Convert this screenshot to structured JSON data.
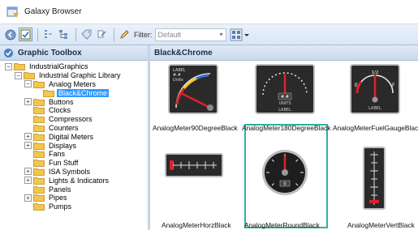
{
  "window": {
    "title": "Galaxy Browser"
  },
  "toolbar": {
    "filter_label": "Filter:",
    "filter_value": "Default",
    "buttons": [
      "back-icon",
      "library-icon",
      "tree-icon",
      "hierarchy-icon",
      "tag-icon",
      "link-icon",
      "edit-icon"
    ]
  },
  "left_panel": {
    "title": "Graphic Toolbox",
    "tree": [
      {
        "label": "IndustrialGraphics",
        "level": 0,
        "expander": "−"
      },
      {
        "label": "Industrial Graphic Library",
        "level": 1,
        "expander": "−"
      },
      {
        "label": "Analog Meters",
        "level": 2,
        "expander": "−"
      },
      {
        "label": "Black&Chrome",
        "level": 3,
        "expander": "",
        "selected": true
      },
      {
        "label": "Buttons",
        "level": 2,
        "expander": "+"
      },
      {
        "label": "Clocks",
        "level": 2,
        "expander": ""
      },
      {
        "label": "Compressors",
        "level": 2,
        "expander": ""
      },
      {
        "label": "Counters",
        "level": 2,
        "expander": ""
      },
      {
        "label": "Digital Meters",
        "level": 2,
        "expander": "+"
      },
      {
        "label": "Displays",
        "level": 2,
        "expander": "+"
      },
      {
        "label": "Fans",
        "level": 2,
        "expander": ""
      },
      {
        "label": "Fun Stuff",
        "level": 2,
        "expander": ""
      },
      {
        "label": "ISA Symbols",
        "level": 2,
        "expander": "+"
      },
      {
        "label": "Lights & Indicators",
        "level": 2,
        "expander": "+"
      },
      {
        "label": "Panels",
        "level": 2,
        "expander": ""
      },
      {
        "label": "Pipes",
        "level": 2,
        "expander": "+"
      },
      {
        "label": "Pumps",
        "level": 2,
        "expander": ""
      }
    ]
  },
  "right_panel": {
    "title": "Black&Chrome",
    "items": [
      {
        "caption": "AnalogMeter90DegreeBlack",
        "thumb_text": [
          "LABEL",
          "#.#",
          "Units"
        ]
      },
      {
        "caption": "AnalogMeter180DegreeBlack",
        "thumb_text": [
          "#.#",
          "UNITS",
          "LABEL"
        ]
      },
      {
        "caption": "AnalogMeterFuelGaugeBlack",
        "thumb_text": [
          "1/2",
          "E",
          "F",
          "LABEL"
        ]
      },
      {
        "caption": "AnalogMeterHorzBlack",
        "thumb_text": []
      },
      {
        "caption": "AnalogMeterRoundBlack",
        "thumb_text": [
          "0"
        ],
        "selected": true
      },
      {
        "caption": "AnalogMeterVertBlack",
        "thumb_text": []
      }
    ]
  },
  "colors": {
    "selection": "#3399ff",
    "selected_frame": "#2bb3a0",
    "header": "#c9d9ec",
    "folder": "#f3c64e",
    "needle_red": "#e0202a"
  }
}
